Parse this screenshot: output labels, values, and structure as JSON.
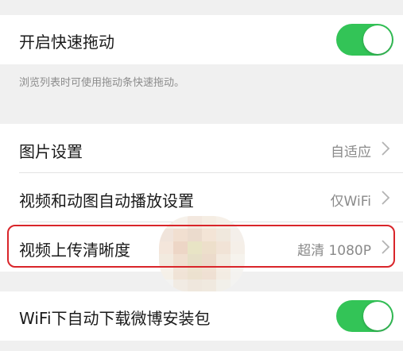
{
  "settings": {
    "fast_drag": {
      "label": "开启快速拖动",
      "enabled": true,
      "description": "浏览列表时可使用拖动条快速拖动。"
    },
    "image": {
      "label": "图片设置",
      "value": "自适应"
    },
    "video_autoplay": {
      "label": "视频和动图自动播放设置",
      "value": "仅WiFi"
    },
    "video_upload": {
      "label": "视频上传清晰度",
      "value": "超清 1080P"
    },
    "wifi_download": {
      "label": "WiFi下自动下载微博安装包",
      "enabled": true
    }
  },
  "colors": {
    "toggle_on": "#33c457",
    "highlight": "#d9252a",
    "background": "#f0f0f0"
  },
  "icons": {
    "chevron": "chevron-right-icon"
  }
}
